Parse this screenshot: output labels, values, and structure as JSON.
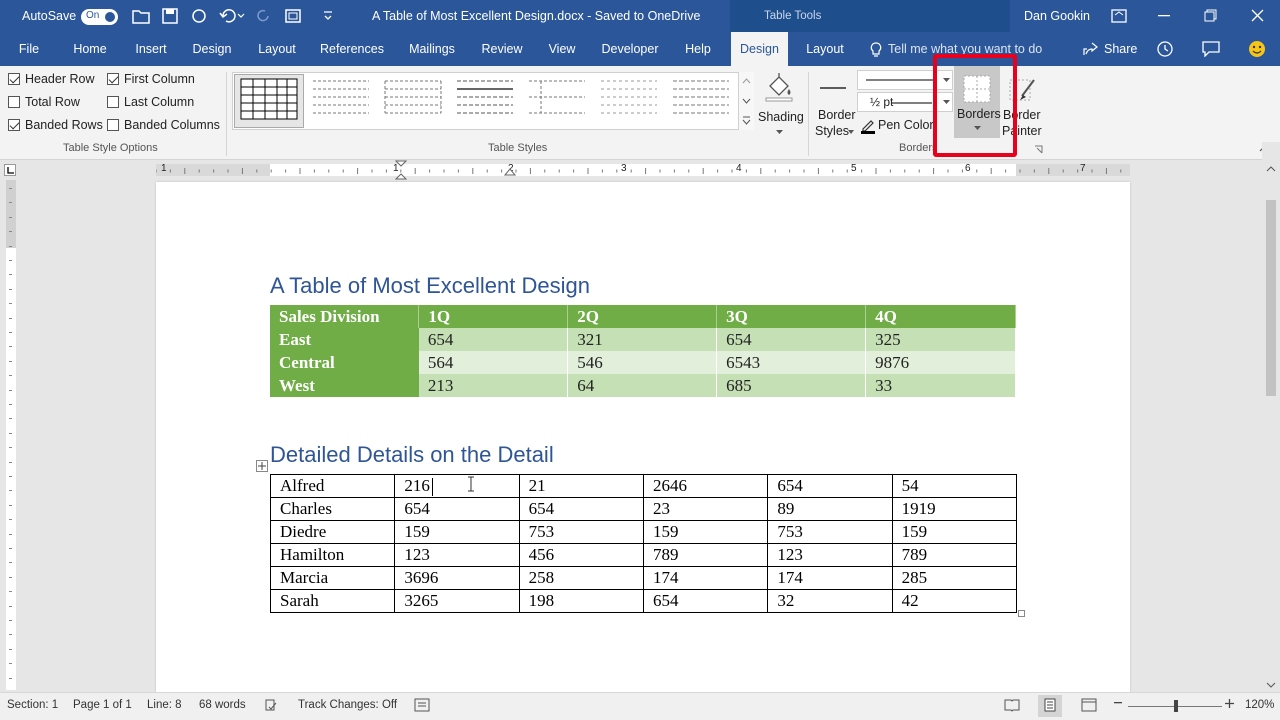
{
  "window": {
    "autosave_label": "AutoSave",
    "autosave_state": "On",
    "doc_title": "A Table of Most Excellent Design.docx  -  Saved to OneDrive",
    "context_title": "Table Tools",
    "user_name": "Dan Gookin"
  },
  "tabs": [
    "File",
    "Home",
    "Insert",
    "Design",
    "Layout",
    "References",
    "Mailings",
    "Review",
    "View",
    "Developer",
    "Help",
    "Design",
    "Layout"
  ],
  "tell_me": "Tell me what you want to do",
  "share_label": "Share",
  "ribbon": {
    "options": {
      "header_row": "Header Row",
      "first_column": "First Column",
      "total_row": "Total Row",
      "last_column": "Last Column",
      "banded_rows": "Banded Rows",
      "banded_columns": "Banded Columns",
      "group_label": "Table Style Options"
    },
    "table_styles_label": "Table Styles",
    "shading_label": "Shading",
    "border_styles_label1": "Border",
    "border_styles_label2": "Styles",
    "pen_weight": "½ pt",
    "pen_color_label": "Pen Color",
    "borders_label": "Borders",
    "border_painter_label1": "Border",
    "border_painter_label2": "Painter",
    "borders_group_label": "Borders"
  },
  "ruler": {
    "numbers": [
      "1",
      "1",
      "2",
      "3",
      "4",
      "5",
      "6",
      "7"
    ]
  },
  "document": {
    "heading1": "A Table of Most Excellent Design",
    "table1": {
      "headers": [
        "Sales Division",
        "1Q",
        "2Q",
        "3Q",
        "4Q"
      ],
      "rows": [
        [
          "East",
          "654",
          "321",
          "654",
          "325"
        ],
        [
          "Central",
          "564",
          "546",
          "6543",
          "9876"
        ],
        [
          "West",
          "213",
          "64",
          "685",
          "33"
        ]
      ]
    },
    "heading2": "Detailed Details on the Detail",
    "table2": {
      "rows": [
        [
          "Alfred",
          "216",
          "21",
          "2646",
          "654",
          "54"
        ],
        [
          "Charles",
          "654",
          "654",
          "23",
          "89",
          "1919"
        ],
        [
          "Diedre",
          "159",
          "753",
          "159",
          "753",
          "159"
        ],
        [
          "Hamilton",
          "123",
          "456",
          "789",
          "123",
          "789"
        ],
        [
          "Marcia",
          "3696",
          "258",
          "174",
          "174",
          "285"
        ],
        [
          "Sarah",
          "3265",
          "198",
          "654",
          "32",
          "42"
        ]
      ]
    }
  },
  "status": {
    "section": "Section: 1",
    "page": "Page 1 of 1",
    "line": "Line: 8",
    "words": "68 words",
    "track_changes": "Track Changes: Off",
    "zoom": "120%"
  },
  "colors": {
    "accent": "#2b579a",
    "header_green": "#70ad47",
    "band_dark": "#c5e0b4",
    "band_light": "#e2efda",
    "heading_blue": "#2f5597",
    "highlight_red": "#e8001c"
  }
}
